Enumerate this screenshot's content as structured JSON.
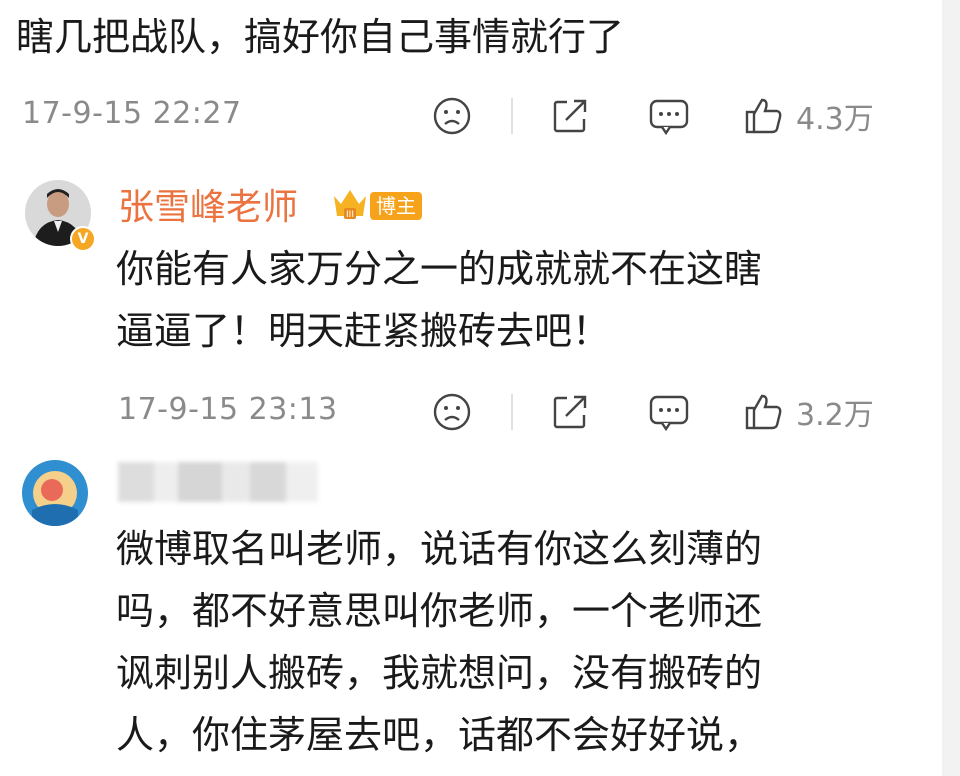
{
  "top_comment": {
    "text": "瞎几把战队，搞好你自己事情就行了",
    "timestamp": "17-9-15 22:27",
    "like_count": "4.3万"
  },
  "reply_1": {
    "username": "张雪峰老师",
    "badge": "博主",
    "lines": [
      "你能有人家万分之一的成就就不在这瞎",
      "逼逼了！明天赶紧搬砖去吧！"
    ],
    "timestamp": "17-9-15 23:13",
    "like_count": "3.2万"
  },
  "reply_2": {
    "lines": [
      "微博取名叫老师，说话有你这么刻薄的",
      "吗，都不好意思叫你老师，一个老师还",
      "讽刺别人搬砖，我就想问，没有搬砖的",
      "人，你住茅屋去吧，话都不会好好说，"
    ]
  },
  "icons": [
    "dislike-icon",
    "share-icon",
    "comment-icon",
    "like-icon",
    "verified-icon",
    "crown-icon"
  ],
  "colors": {
    "username": "#eb7340",
    "badge": "#f7a21b",
    "meta": "#8a8a8a"
  }
}
